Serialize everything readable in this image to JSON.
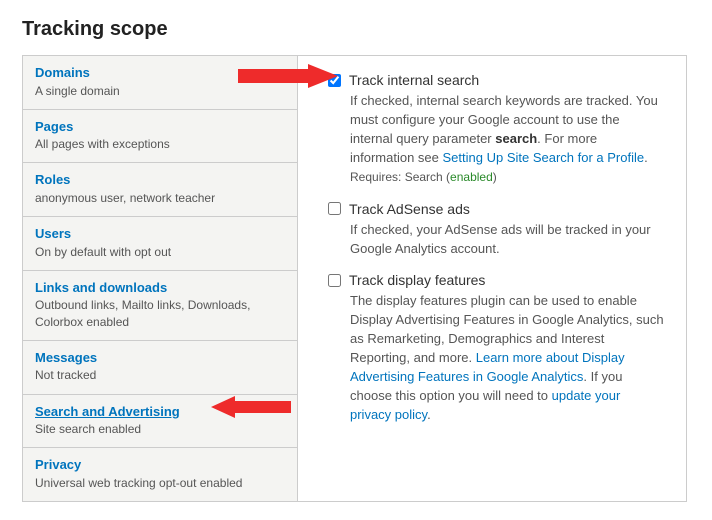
{
  "page": {
    "title": "Tracking scope"
  },
  "sidebar": {
    "items": [
      {
        "title": "Domains",
        "sub": "A single domain"
      },
      {
        "title": "Pages",
        "sub": "All pages with exceptions"
      },
      {
        "title": "Roles",
        "sub": "anonymous user, network teacher"
      },
      {
        "title": "Users",
        "sub": "On by default with opt out"
      },
      {
        "title": "Links and downloads",
        "sub": "Outbound links, Mailto links, Downloads, Colorbox enabled"
      },
      {
        "title": "Messages",
        "sub": "Not tracked"
      },
      {
        "title": "Search and Advertising",
        "sub": "Site search enabled"
      },
      {
        "title": "Privacy",
        "sub": "Universal web tracking opt-out enabled"
      }
    ],
    "active_index": 6
  },
  "content": {
    "options": [
      {
        "label": "Track internal search",
        "checked": true,
        "desc_parts": {
          "pre": "If checked, internal search keywords are tracked. You must configure your Google account to use the internal query parameter ",
          "bold": "search",
          "mid": ". For more information see ",
          "link": "Setting Up Site Search for a Profile",
          "post": "."
        },
        "requires": {
          "prefix": "Requires: Search (",
          "status": "enabled",
          "suffix": ")"
        }
      },
      {
        "label": "Track AdSense ads",
        "checked": false,
        "desc_plain": "If checked, your AdSense ads will be tracked in your Google Analytics account."
      },
      {
        "label": "Track display features",
        "checked": false,
        "desc_parts2": {
          "pre": "The display features plugin can be used to enable Display Advertising Features in Google Analytics, such as Remarketing, Demographics and Interest Reporting, and more. ",
          "link1": "Learn more about Display Advertising Features in Google Analytics",
          "mid": ". If you choose this option you will need to ",
          "link2": "update your privacy policy",
          "post": "."
        }
      }
    ]
  }
}
